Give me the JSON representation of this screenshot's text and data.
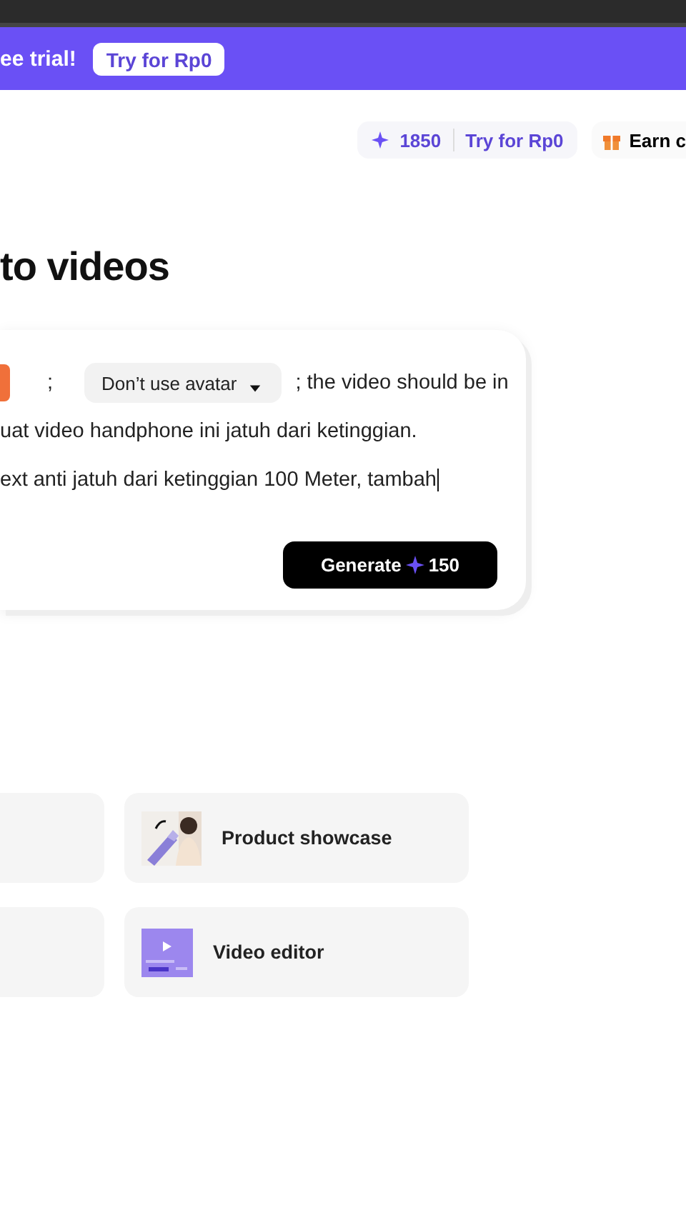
{
  "banner": {
    "text": "ee trial!",
    "button": "Try for Rp0"
  },
  "header": {
    "credits": "1850",
    "trial_link": "Try for Rp0",
    "earn": "Earn c"
  },
  "title": "to videos",
  "prompt": {
    "separator_1": ";",
    "avatar_dropdown": "Don’t use avatar",
    "line_1_rest": "; the video should be in",
    "line_2": "uat video handphone ini jatuh dari ketinggian.",
    "line_3": "ext anti jatuh dari ketinggian 100 Meter, tambah",
    "generate_button": "Generate",
    "generate_cost": "150"
  },
  "tools": [
    {
      "kind": "blank"
    },
    {
      "label": "Product showcase",
      "kind": "picture"
    },
    {
      "kind": "blank"
    },
    {
      "label": "Video editor",
      "kind": "editor"
    }
  ]
}
